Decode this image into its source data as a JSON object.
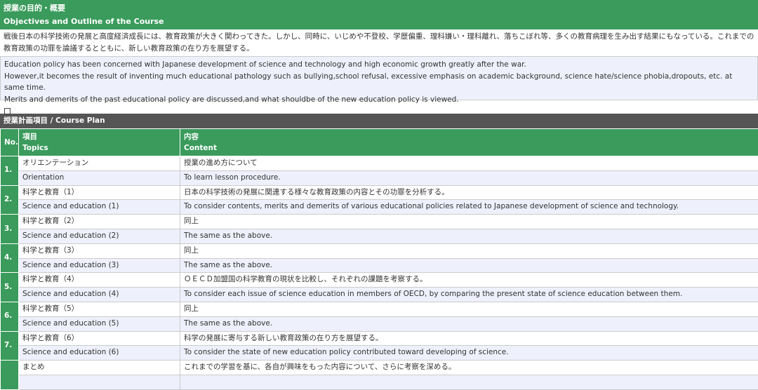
{
  "objectives": {
    "title_jp": "授業の目的・概要",
    "title_en": "Objectives and Outline of the Course",
    "jp_text": "戦後日本の科学技術の発展と高度経済成長には、教育政策が大きく関わってきた。しかし、同時に、いじめや不登校、学歴偏重、理科嫌い・理科離れ、落ちこぼれ等、多くの教育病理を生み出す結果にもなっている。これまでの教育政策の功罪を論議するとともに、新しい教育政策の在り方を展望する。",
    "en_lines": [
      "Education policy has been concerned with Japanese development of science and technology and high economic growth greatly after the war.",
      "However,it becomes the result of inventing much educational pathology such as bullying,school refusal, excessive emphasis on academic background, science hate/science phobia,dropouts, etc. at same time.",
      "Merits and demerits of the past educational policy are discussed,and what shouldbe of the new education policy is viewed."
    ]
  },
  "plan": {
    "title": "授業計画項目 / Course Plan",
    "headers": {
      "no": "No.",
      "topics_jp": "項目",
      "topics_en": "Topics",
      "content_jp": "内容",
      "content_en": "Content"
    },
    "rows": [
      {
        "no": "1.",
        "topic_jp": "オリエンテーション",
        "topic_en": "Orientation",
        "content_jp": "授業の進め方について",
        "content_en": "To learn lesson procedure."
      },
      {
        "no": "2.",
        "topic_jp": "科学と教育（1）",
        "topic_en": "Science and education (1)",
        "content_jp": "日本の科学技術の発展に関連する様々な教育政策の内容とその功罪を分析する。",
        "content_en": "To consider contents, merits and demerits of various educational policies related to Japanese development of science and technology."
      },
      {
        "no": "3.",
        "topic_jp": "科学と教育（2）",
        "topic_en": "Science and education (2)",
        "content_jp": "同上",
        "content_en": "The same as the above."
      },
      {
        "no": "4.",
        "topic_jp": "科学と教育（3）",
        "topic_en": "Science and education (3)",
        "content_jp": "同上",
        "content_en": "The same as the above."
      },
      {
        "no": "5.",
        "topic_jp": "科学と教育（4）",
        "topic_en": "Science and education (4)",
        "content_jp": "ＯＥＣＤ加盟国の科学教育の現状を比較し、それぞれの課題を考察する。",
        "content_en": "To consider each issue of science education in members of OECD, by comparing the present state of science education between them."
      },
      {
        "no": "6.",
        "topic_jp": "科学と教育（5）",
        "topic_en": "Science and education (5)",
        "content_jp": "同上",
        "content_en": "The same as the above."
      },
      {
        "no": "7.",
        "topic_jp": "科学と教育（6）",
        "topic_en": "Science and education (6)",
        "content_jp": "科学の発展に寄与する新しい教育政策の在り方を展望する。",
        "content_en": "To consider the state of new education policy contributed toward developing of science."
      },
      {
        "no": "",
        "topic_jp": "まとめ",
        "topic_en": "",
        "content_jp": "これまでの学習を基に、各自が興味をもった内容について、さらに考察を深める。",
        "content_en": ""
      }
    ]
  }
}
